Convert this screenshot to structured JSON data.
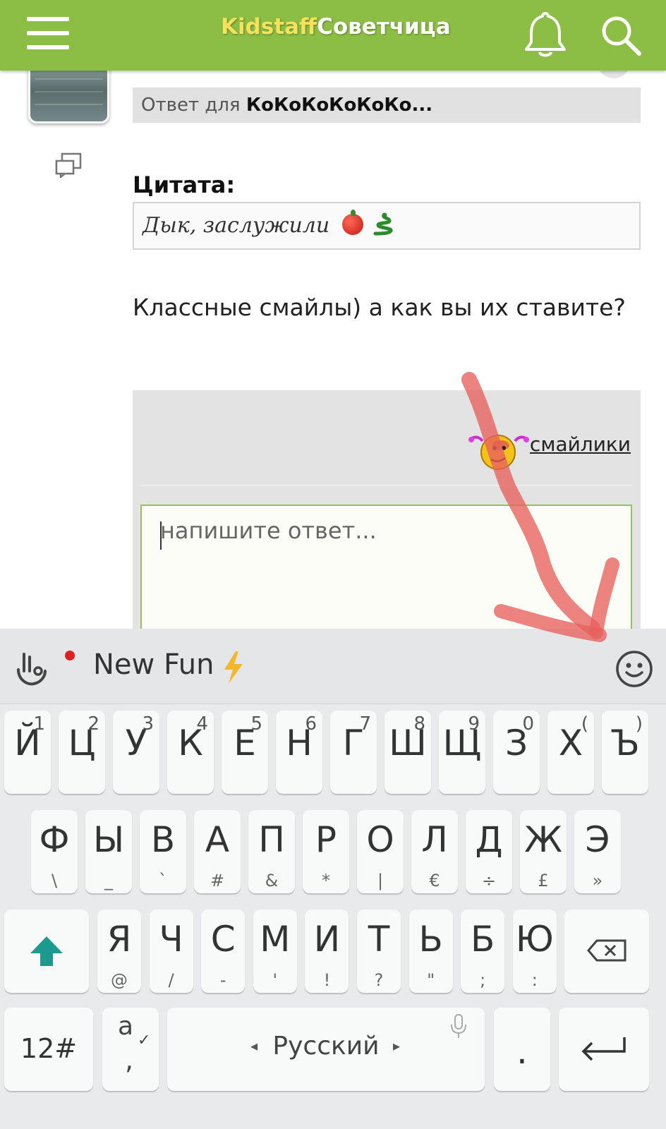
{
  "header": {
    "logo_part1": "Kidstaff",
    "logo_part2": "Советчица"
  },
  "post": {
    "reply_to_prefix": "Ответ для ",
    "reply_to_name": "КоКоКоКоКоКо...",
    "quote_title": "Цитата:",
    "quote_text": "Дык, заслужили",
    "message": "Классные смайлы) а как вы их ставите?"
  },
  "reply_form": {
    "smileys_link": "смайлики",
    "textarea_placeholder": "напишите ответ..."
  },
  "keyboard": {
    "suggestion": "New Fun",
    "row1": [
      {
        "main": "Й",
        "sub": "1"
      },
      {
        "main": "Ц",
        "sub": "2"
      },
      {
        "main": "У",
        "sub": "3"
      },
      {
        "main": "К",
        "sub": "4"
      },
      {
        "main": "Е",
        "sub": "5"
      },
      {
        "main": "Н",
        "sub": "6"
      },
      {
        "main": "Г",
        "sub": "7"
      },
      {
        "main": "Ш",
        "sub": "8"
      },
      {
        "main": "Щ",
        "sub": "9"
      },
      {
        "main": "З",
        "sub": "0"
      },
      {
        "main": "Х",
        "sub": "("
      },
      {
        "main": "Ъ",
        "sub": ")"
      }
    ],
    "row2": [
      {
        "main": "Ф",
        "sub": "\\"
      },
      {
        "main": "Ы",
        "sub": "_"
      },
      {
        "main": "В",
        "sub": "`"
      },
      {
        "main": "А",
        "sub": "#"
      },
      {
        "main": "П",
        "sub": "&"
      },
      {
        "main": "Р",
        "sub": "*"
      },
      {
        "main": "О",
        "sub": "|"
      },
      {
        "main": "Л",
        "sub": "€"
      },
      {
        "main": "Д",
        "sub": "÷"
      },
      {
        "main": "Ж",
        "sub": "£"
      },
      {
        "main": "Э",
        "sub": "»"
      }
    ],
    "row3": [
      {
        "main": "Я",
        "sub": "@"
      },
      {
        "main": "Ч",
        "sub": "/"
      },
      {
        "main": "С",
        "sub": "-"
      },
      {
        "main": "М",
        "sub": "'"
      },
      {
        "main": "И",
        "sub": "!"
      },
      {
        "main": "Т",
        "sub": "?"
      },
      {
        "main": "Ь",
        "sub": "\""
      },
      {
        "main": "Б",
        "sub": ";"
      },
      {
        "main": "Ю",
        "sub": ":"
      }
    ],
    "numbers_key": "12#",
    "lang_key_top": "а",
    "lang_key_bottom": ",",
    "space_label": "Русский",
    "period_key": "."
  },
  "colors": {
    "header": "#8cbd45",
    "logo_accent": "#f3e25a",
    "arrow": "#e8605c"
  }
}
